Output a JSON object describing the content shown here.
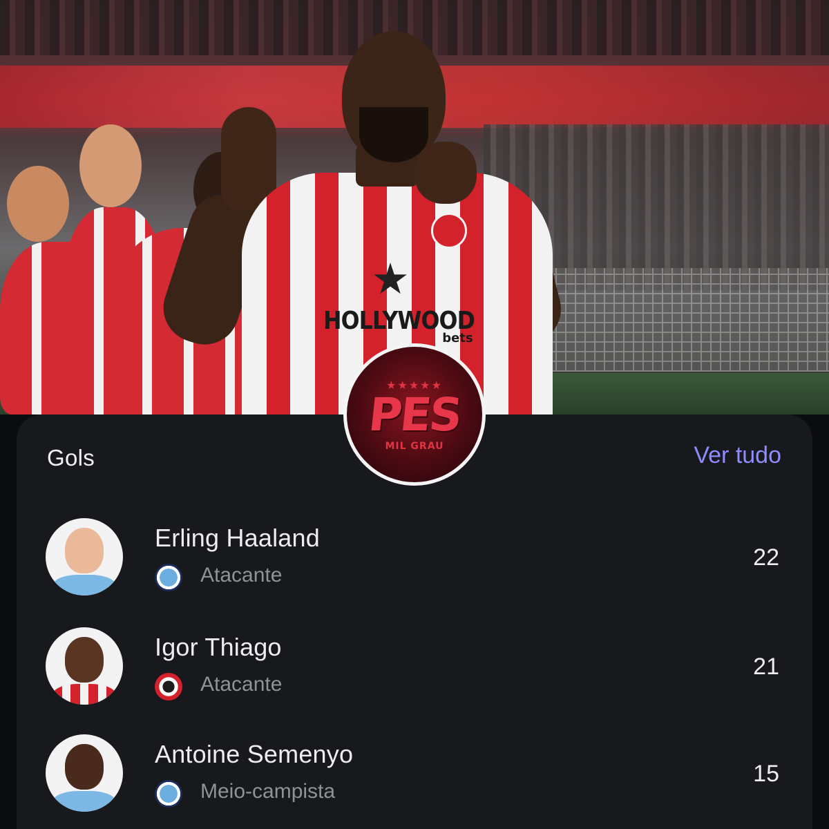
{
  "logo": {
    "stars": "★★★★★",
    "title": "PES",
    "subtitle": "MIL GRAU"
  },
  "hero": {
    "sponsor_line1": "HOLLYWOOD",
    "sponsor_line2": "bets"
  },
  "card": {
    "title": "Gols",
    "view_all": "Ver tudo",
    "accent_color": "#8e8cff",
    "players": [
      {
        "name": "Erling Haaland",
        "position": "Atacante",
        "club_icon": "manchester-city-badge-icon",
        "goals": "22"
      },
      {
        "name": "Igor Thiago",
        "position": "Atacante",
        "club_icon": "brentford-badge-icon",
        "goals": "21"
      },
      {
        "name": "Antoine Semenyo",
        "position": "Meio-campista",
        "club_icon": "manchester-city-badge-icon",
        "goals": "15"
      }
    ]
  }
}
